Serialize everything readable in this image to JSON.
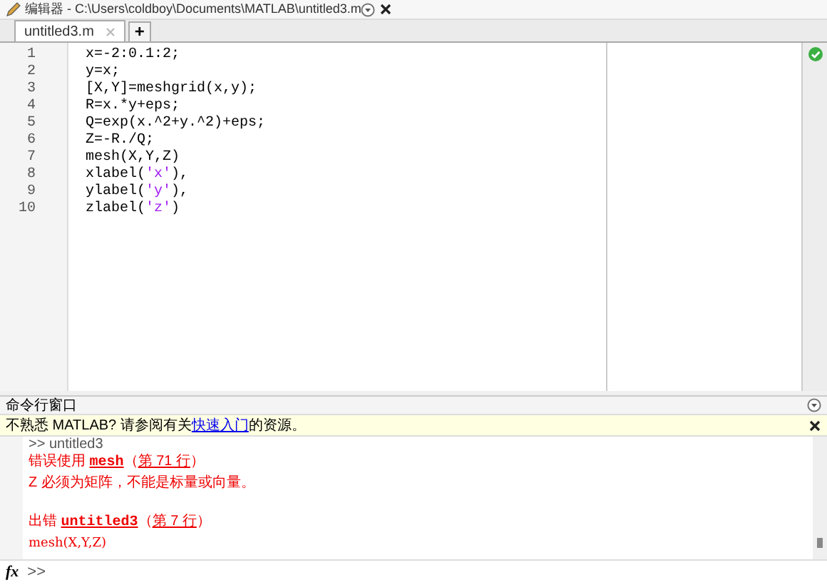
{
  "window": {
    "title": "编辑器 - C:\\Users\\coldboy\\Documents\\MATLAB\\untitled3.m"
  },
  "tabs": [
    {
      "label": "untitled3.m",
      "selected": true
    }
  ],
  "new_tab": "+",
  "editor": {
    "lines": [
      {
        "number": "1",
        "segments": [
          {
            "text": "x=-2:0.1:2;",
            "kind": "code"
          }
        ]
      },
      {
        "number": "2",
        "segments": [
          {
            "text": "y=x;",
            "kind": "code"
          }
        ]
      },
      {
        "number": "3",
        "segments": [
          {
            "text": "[X,Y]=meshgrid(x,y);",
            "kind": "code"
          }
        ]
      },
      {
        "number": "4",
        "segments": [
          {
            "text": "R=x.*y+eps;",
            "kind": "code"
          }
        ]
      },
      {
        "number": "5",
        "segments": [
          {
            "text": "Q=exp(x.^2+y.^2)+eps;",
            "kind": "code"
          }
        ]
      },
      {
        "number": "6",
        "segments": [
          {
            "text": "Z=-R./Q;",
            "kind": "code"
          }
        ]
      },
      {
        "number": "7",
        "segments": [
          {
            "text": "mesh(X,Y,Z)",
            "kind": "code"
          }
        ]
      },
      {
        "number": "8",
        "segments": [
          {
            "text": "xlabel(",
            "kind": "code"
          },
          {
            "text": "'x'",
            "kind": "string"
          },
          {
            "text": "),",
            "kind": "code"
          }
        ]
      },
      {
        "number": "9",
        "segments": [
          {
            "text": "ylabel(",
            "kind": "code"
          },
          {
            "text": "'y'",
            "kind": "string"
          },
          {
            "text": "),",
            "kind": "code"
          }
        ]
      },
      {
        "number": "10",
        "segments": [
          {
            "text": "zlabel(",
            "kind": "code"
          },
          {
            "text": "'z'",
            "kind": "string"
          },
          {
            "text": ")",
            "kind": "code"
          }
        ]
      }
    ]
  },
  "command_window": {
    "title": "命令行窗口",
    "notice": [
      {
        "text": "不熟悉 MATLAB? 请参阅有关",
        "kind": "text"
      },
      {
        "text": "快速入门",
        "kind": "link"
      },
      {
        "text": "的资源。",
        "kind": "text"
      }
    ],
    "output": [
      {
        "kind": "echo",
        "blank_before": false,
        "segments": [
          {
            "text": ">> untitled3",
            "kind": "text"
          }
        ]
      },
      {
        "kind": "error",
        "blank_before": false,
        "segments": [
          {
            "text": "错误使用 ",
            "kind": "text"
          },
          {
            "text": "mesh",
            "kind": "link"
          },
          {
            "text": "（",
            "kind": "text"
          },
          {
            "text": "第 71 行",
            "kind": "line_link"
          },
          {
            "text": "）",
            "kind": "text"
          }
        ]
      },
      {
        "kind": "error",
        "blank_before": false,
        "segments": [
          {
            "text": "Z 必须为矩阵，不能是标量或向量。",
            "kind": "text"
          }
        ]
      },
      {
        "kind": "error",
        "blank_before": true,
        "segments": [
          {
            "text": "出错 ",
            "kind": "text"
          },
          {
            "text": "untitled3",
            "kind": "link"
          },
          {
            "text": "（",
            "kind": "text"
          },
          {
            "text": "第 7 行",
            "kind": "line_link"
          },
          {
            "text": "）",
            "kind": "text"
          }
        ]
      },
      {
        "kind": "error_code",
        "blank_before": false,
        "segments": [
          {
            "text": "mesh(X,Y,Z)",
            "kind": "text"
          }
        ]
      }
    ],
    "prompt_icon": "fx",
    "prompt": ">>"
  }
}
